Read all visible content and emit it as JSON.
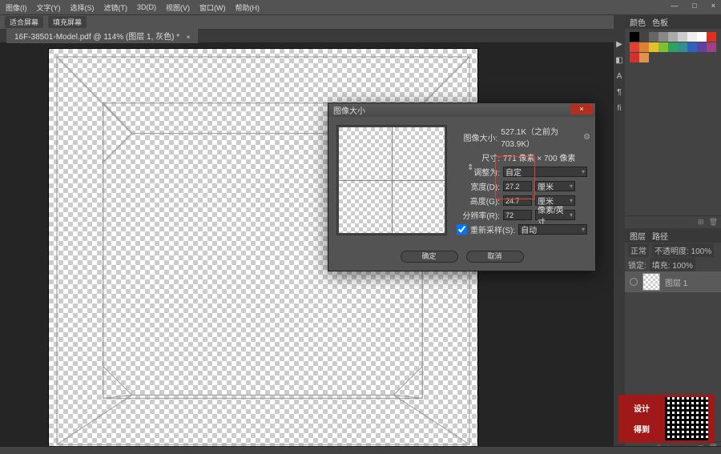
{
  "menu": {
    "items": [
      "图像(I)",
      "文字(Y)",
      "选择(S)",
      "滤镜(T)",
      "3D(D)",
      "视图(V)",
      "窗口(W)",
      "帮助(H)"
    ]
  },
  "winControls": {
    "min": "—",
    "max": "□",
    "close": "×"
  },
  "optbar": {
    "label1": "适合屏幕",
    "label2": "填充屏幕"
  },
  "tab": {
    "title": "16F-38501-Model.pdf @ 114% (图层 1, 灰色) *",
    "close": "×"
  },
  "rightTabs": {
    "color": "颜色",
    "swatches": "色板"
  },
  "layersPanel": {
    "tab1": "图层",
    "tab2": "路径",
    "mode": "正常",
    "opacity": "不透明度: 100%",
    "lockRow": "锁定:",
    "fill": "填充: 100%",
    "layerName": "图层 1"
  },
  "dialog": {
    "title": "图像大小",
    "infoLabel": "图像大小:",
    "infoVal": "527.1K（之前为703.9K）",
    "dimLabel": "尺寸:",
    "dimVal": "771 像素 × 700 像素",
    "fitLabel": "调整为:",
    "fitVal": "自定",
    "wLabel": "宽度(D):",
    "wVal": "27.2",
    "wUnit": "厘米",
    "hLabel": "高度(G):",
    "hVal": "24.7",
    "hUnit": "厘米",
    "resLabel": "分辨率(R):",
    "resVal": "72",
    "resUnit": "像素/英寸",
    "resample": "重新采样(S):",
    "resampleVal": "自动",
    "ok": "确定",
    "cancel": "取消",
    "gear": "⚙"
  },
  "swatchColors": [
    [
      "#000",
      "#444",
      "#666",
      "#888",
      "#aaa",
      "#ccc",
      "#eee",
      "#fff",
      "#e03020"
    ],
    [
      "#e04030",
      "#e08030",
      "#e0c030",
      "#80c030",
      "#30a060",
      "#309090",
      "#3060c0",
      "#6040a0",
      "#a04080"
    ],
    [
      "#d03030",
      "#e09050",
      "#000",
      "#000",
      "#000",
      "#000",
      "#000",
      "#000",
      "#000"
    ]
  ],
  "watermark": {
    "line1": "设计",
    "line2": "得到"
  }
}
